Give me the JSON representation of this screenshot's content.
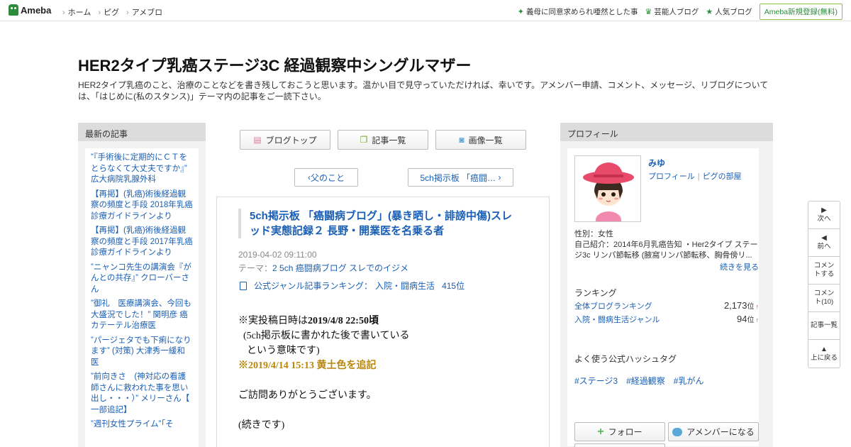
{
  "header": {
    "logo": "Ameba",
    "nav": [
      "ホーム",
      "ピグ",
      "アメブロ"
    ],
    "right_links": [
      {
        "icon": "sparkle-icon",
        "label": "義母に同意求められ唖然とした事"
      },
      {
        "icon": "crown-icon",
        "label": "芸能人ブログ"
      },
      {
        "icon": "star-icon",
        "label": "人気ブログ"
      }
    ],
    "signup": "Ameba新規登録(無料)"
  },
  "blog": {
    "title": "HER2タイプ乳癌ステージ3C 経過観察中シングルマザー",
    "description": "HER2タイプ乳癌のこと、治療のことなどを書き残しておこうと思います。温かい目で見守っていただければ、幸いです。アメンバー申請、コメント、メッセージ、リブログについては、「はじめに(私のスタンス)」テーマ内の記事をご一読下さい。"
  },
  "recent": {
    "heading": "最新の記事",
    "items": [
      "”『手術後に定期的にＣＴをとらなくて大丈夫ですか』” 広大病院乳腺外科",
      "【再掲】(乳癌)術後経過観察の頻度と手段 2018年乳癌診療ガイドラインより",
      "【再掲】(乳癌)術後経過観察の頻度と手段 2017年乳癌診療ガイドラインより",
      "”ニャンコ先生の講演会『がんとの共存』” クローバーさん",
      "”御礼　医療講演会、今回も大盛況でした！” 関明彦 癌カテーテル治療医",
      "”パージェタでも下痢になりますˮ (対策) 大津秀一緩和医",
      "”前向きさ　(神対応の看護師さんに救われた事を思い出し・・・）” メリーさん【 一部追記】",
      "”週刊女性プライム”「そ"
    ]
  },
  "tabs": [
    {
      "icon": "notebook-icon",
      "label": "ブログトップ"
    },
    {
      "icon": "copy-icon",
      "label": "記事一覧"
    },
    {
      "icon": "camera-icon",
      "label": "画像一覧"
    }
  ],
  "pager": {
    "prev": "父のこと",
    "next": "5ch掲示板 「癌闘…"
  },
  "article": {
    "title": "5ch掲示板 「癌闘病ブログ」(暴き晒し・誹謗中傷)スレッド実態記録２ 長野・開業医を名乗る者",
    "date": "2019-04-02 09:11:00",
    "theme_label": "テーマ：",
    "theme": "2 5ch 癌闘病ブログ スレでのイジメ",
    "ranking_label": "公式ジャンル記事ランキング：",
    "ranking_genre": "入院・闘病生活",
    "ranking_rank": "415位",
    "body": {
      "line1_prefix": "※実投稿日時は",
      "line1_bold": "2019/4/8 22:50頃",
      "line2": "(5ch掲示板に書かれた後で書いている",
      "line3": "という意味です)",
      "line4": "※2019/4/14 15:13 黄土色を追記",
      "line5": "ご訪問ありがとうございます。",
      "line6": "(続きです)"
    }
  },
  "profile": {
    "heading": "プロフィール",
    "name": "みゆ",
    "link1": "プロフィール",
    "link2": "ピグの部屋",
    "gender": "性別：女性",
    "intro": "自己紹介：2014年6月乳癌告知 ・Her2タイプ ステージ3c リンパ節転移 (腋窩リンパ節転移、胸骨傍リ...",
    "more": "続きを見る",
    "ranking_heading": "ランキング",
    "rankings": [
      {
        "label": "全体ブログランキング",
        "value": "2,173",
        "unit": "位",
        "trend": "↑"
      },
      {
        "label": "入院・闘病生活ジャンル",
        "value": "94",
        "unit": "位",
        "trend": "↑"
      }
    ],
    "hashtag_heading": "よく使う公式ハッシュタグ",
    "hashtags": [
      "#ステージ3",
      "#経過観察",
      "#乳がん"
    ],
    "follow": "フォロー",
    "amember": "アメンバーになる"
  },
  "sidenav": [
    {
      "icon": "triangle-right-icon",
      "label": "次へ"
    },
    {
      "icon": "triangle-left-icon",
      "label": "前へ"
    },
    {
      "icon": "",
      "label": "コメントする"
    },
    {
      "icon": "",
      "label": "コメント(10)"
    },
    {
      "icon": "",
      "label": "記事一覧"
    },
    {
      "icon": "triangle-up-icon",
      "label": "上に戻る"
    }
  ]
}
